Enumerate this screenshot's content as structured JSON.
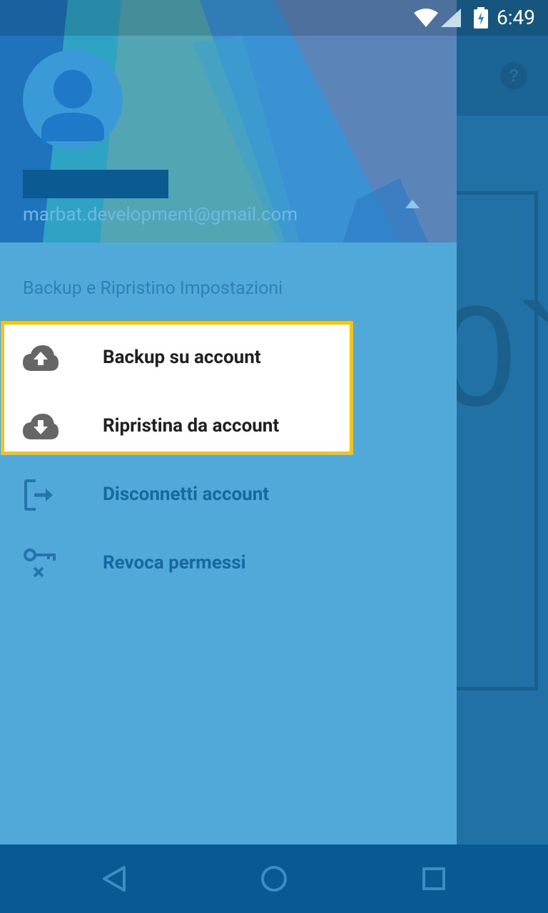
{
  "status_bar": {
    "time": "6:49"
  },
  "drawer": {
    "account": {
      "email": "marbat.development@gmail.com"
    },
    "section_title": "Backup e Ripristino Impostazioni",
    "items": [
      {
        "label": "Backup su account",
        "icon": "cloud-upload-icon"
      },
      {
        "label": "Ripristina da account",
        "icon": "cloud-download-icon"
      },
      {
        "label": "Disconnetti account",
        "icon": "logout-icon"
      },
      {
        "label": "Revoca permessi",
        "icon": "key-remove-icon"
      }
    ]
  },
  "background_app": {
    "visible_glyph": "0`"
  },
  "colors": {
    "drawer_bg": "#51a9da",
    "highlight_border": "#f5c316",
    "nav_bar": "#085a92"
  }
}
